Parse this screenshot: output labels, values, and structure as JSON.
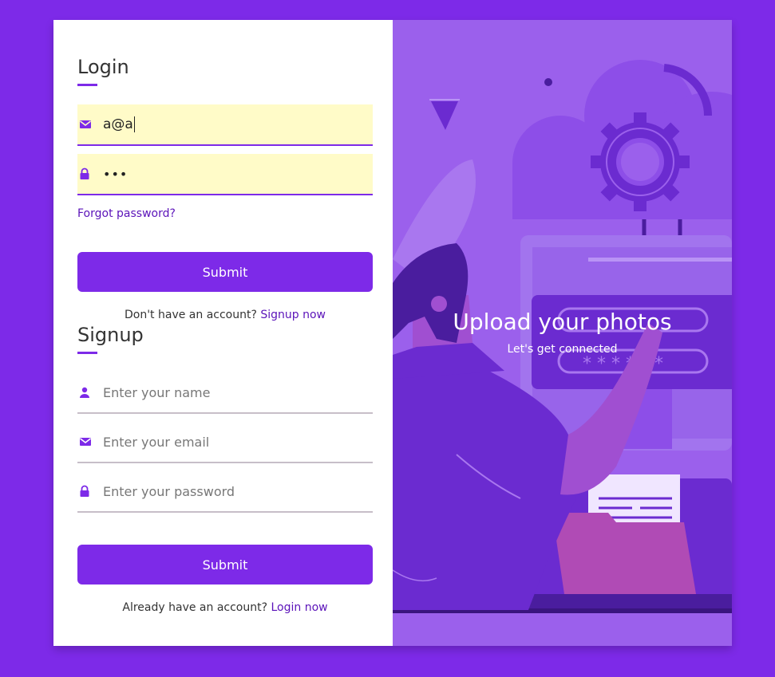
{
  "login": {
    "title": "Login",
    "email_value": "a@a",
    "password_value": "•••",
    "forgot_label": "Forgot password?",
    "submit_label": "Submit",
    "switch_text": "Don't have an account?",
    "switch_link": "Signup now"
  },
  "signup": {
    "title": "Signup",
    "name_placeholder": "Enter your name",
    "email_placeholder": "Enter your email",
    "password_placeholder": "Enter your password",
    "submit_label": "Submit",
    "switch_text": "Already have an account?",
    "switch_link": "Login now"
  },
  "hero": {
    "heading": "Upload your photos",
    "subheading": "Let's get connected"
  },
  "icons": {
    "email": "envelope-icon",
    "lock": "lock-icon",
    "user": "user-icon"
  },
  "colors": {
    "accent": "#7d2ae8",
    "link": "#5b13b9",
    "autofill": "#fffbc8",
    "illustration_bg": "#9b60ec"
  }
}
